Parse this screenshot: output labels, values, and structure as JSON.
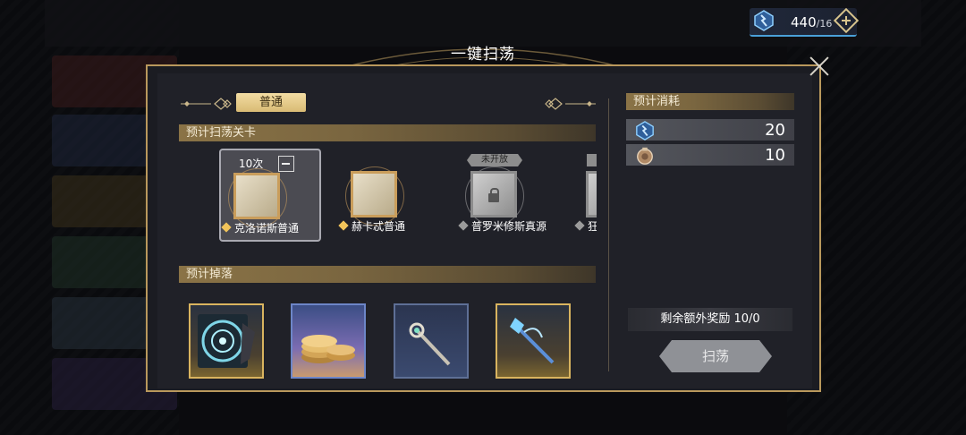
{
  "resource": {
    "value": "440",
    "max": "/16"
  },
  "dialog": {
    "title": "一键扫荡",
    "tab_label": "普通",
    "section_stages": "预计扫荡关卡",
    "section_drops": "预计掉落",
    "section_cost": "预计消耗"
  },
  "stages": [
    {
      "count": "10次",
      "name": "克洛诺斯普通",
      "locked": false,
      "not_open_label": ""
    },
    {
      "count": "",
      "name": "赫卡忒普通",
      "locked": false,
      "not_open_label": ""
    },
    {
      "count": "",
      "name": "普罗米修斯真源",
      "locked": true,
      "not_open_label": "未开放"
    },
    {
      "count": "",
      "name": "狂",
      "locked": true,
      "not_open_label": ""
    }
  ],
  "drops": [
    {
      "icon": "record-disc-icon",
      "rarity": "gold"
    },
    {
      "icon": "gold-coins-icon",
      "rarity": "blue"
    },
    {
      "icon": "scepter-icon",
      "rarity": "navy"
    },
    {
      "icon": "crystal-staff-icon",
      "rarity": "gold"
    }
  ],
  "costs": [
    {
      "icon": "stamina-icon",
      "value": "20"
    },
    {
      "icon": "ticket-icon",
      "value": "10"
    }
  ],
  "bonus_text": "剩余额外奖励  10/0",
  "sweep_label": "扫荡",
  "colors": {
    "accent_gold": "#d9bb74",
    "stamina_blue": "#4aa0d8"
  }
}
